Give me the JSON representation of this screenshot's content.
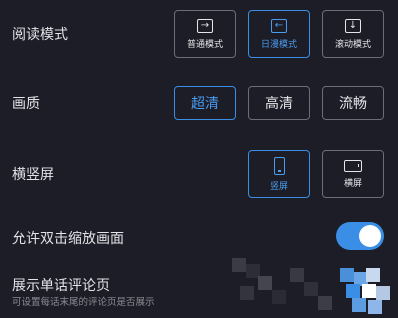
{
  "reading_mode": {
    "label": "阅读模式",
    "options": [
      {
        "label": "普通模式",
        "icon": "arrow-right-icon",
        "selected": false
      },
      {
        "label": "日漫模式",
        "icon": "arrow-left-icon",
        "selected": true
      },
      {
        "label": "滚动模式",
        "icon": "arrow-down-icon",
        "selected": false
      }
    ]
  },
  "quality": {
    "label": "画质",
    "options": [
      {
        "label": "超清",
        "selected": true
      },
      {
        "label": "高清",
        "selected": false
      },
      {
        "label": "流畅",
        "selected": false
      }
    ]
  },
  "orientation": {
    "label": "横竖屏",
    "options": [
      {
        "label": "竖屏",
        "icon": "portrait-phone-icon",
        "selected": true
      },
      {
        "label": "横屏",
        "icon": "landscape-phone-icon",
        "selected": false
      }
    ]
  },
  "double_tap_zoom": {
    "label": "允许双击缩放画面",
    "enabled": true
  },
  "show_comments": {
    "label": "展示单话评论页",
    "description": "可设置每话末尾的评论页是否展示"
  },
  "colors": {
    "background": "#1c1d26",
    "accent": "#3a8ee6",
    "border": "#6c6d76"
  }
}
